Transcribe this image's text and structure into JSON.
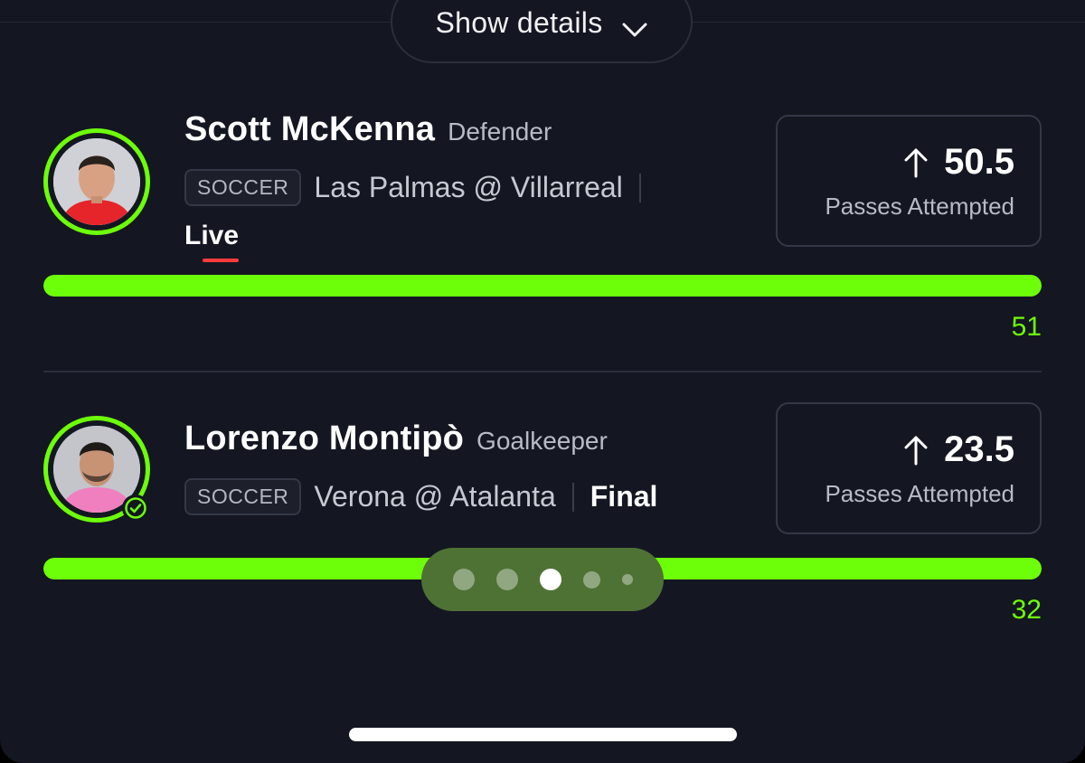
{
  "header": {
    "show_details_label": "Show details",
    "chevron_icon": "chevron-down-icon"
  },
  "picks": [
    {
      "player": "Scott McKenna",
      "position": "Defender",
      "sport": "SOCCER",
      "matchup": "Las Palmas @ Villarreal",
      "status": "Live",
      "status_color": "#ff3b3b",
      "direction_icon": "arrow-up-icon",
      "line": "50.5",
      "stat": "Passes Attempted",
      "actual": "51",
      "progress": 1.0
    },
    {
      "player": "Lorenzo Montipò",
      "position": "Goalkeeper",
      "sport": "SOCCER",
      "matchup": "Verona @ Atalanta",
      "status": "Final",
      "direction_icon": "arrow-up-icon",
      "line": "23.5",
      "stat": "Passes Attempted",
      "actual": "32",
      "progress": 1.0,
      "result_icon": "check-circle-icon"
    }
  ],
  "pager": {
    "pages": 5,
    "active_page": 3
  },
  "colors": {
    "accent": "#6dff0a",
    "background": "#141722",
    "live": "#ff3b3b",
    "pager_bg": "#4e7234"
  }
}
